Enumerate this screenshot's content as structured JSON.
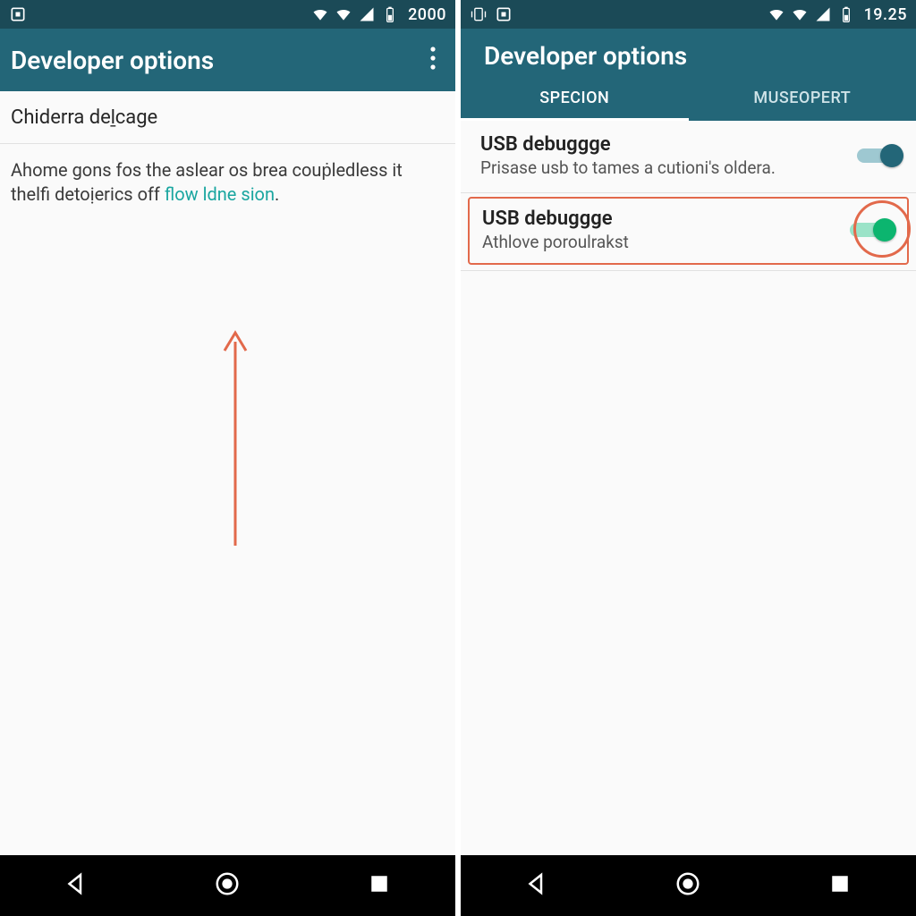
{
  "left": {
    "status_time": "2000",
    "appbar_title": "Developer options",
    "section_heading": "Chiderra deḻcage",
    "note_prefix": "Ahome gons fos the aslear os brea couṗledless it thelfi detoịerics off ",
    "note_link": "flow ldne sion",
    "note_suffix": "."
  },
  "right": {
    "status_time": "19.25",
    "appbar_title": "Developer options",
    "tabs": {
      "a": "SPECION",
      "b": "MUSEOPERT"
    },
    "row1": {
      "title": "USB debuggge",
      "sub": "Prisase usb to tames a cutioni's oldera."
    },
    "row2": {
      "title": "USB debuggge",
      "sub": "Athlove poroulrakst"
    }
  }
}
